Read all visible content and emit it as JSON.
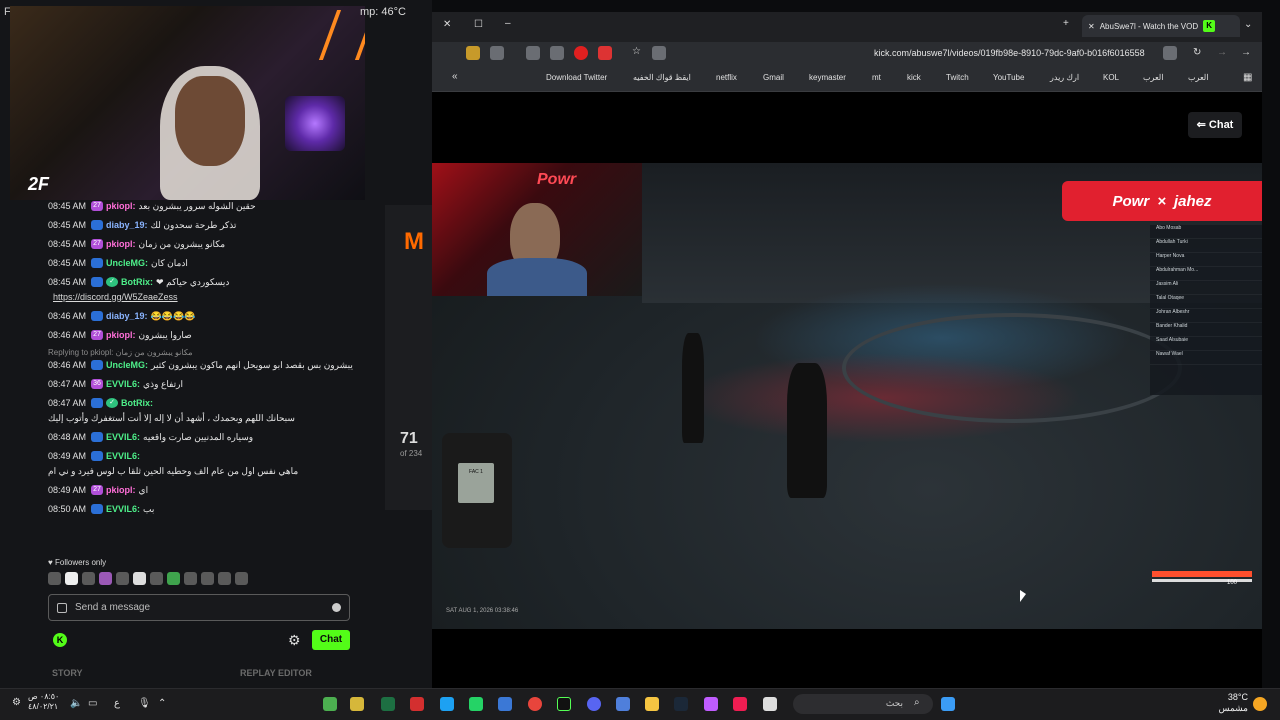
{
  "overlay": {
    "temp": "mp: 46°C",
    "corner_letter": "F"
  },
  "chat": {
    "messages": [
      {
        "time": "08:45 AM",
        "badge": "27",
        "badge_color": "#b14fd8",
        "user": "pkiopl:",
        "user_color": "#ff6fd8",
        "text": "حقين الشوله سرور يبشرون بعد"
      },
      {
        "time": "08:45 AM",
        "badge": "",
        "user": "diaby_19:",
        "user_color": "#8ab4ff",
        "text": "تذكر طرحة سحدون لك"
      },
      {
        "time": "08:45 AM",
        "badge": "27",
        "badge_color": "#b14fd8",
        "user": "pkiopl:",
        "user_color": "#ff6fd8",
        "text": "مكانو يبشرون من زمان"
      },
      {
        "time": "08:45 AM",
        "badge": "",
        "user": "UncleMG:",
        "user_color": "#4ef08a",
        "text": "ادمان كان"
      },
      {
        "time": "08:45 AM",
        "badge": "",
        "user": "BotRix:",
        "user_color": "#4ef08a",
        "text": "ديسكوردي حياكم ❤",
        "link": "https://discord.gg/W5ZeaeZess"
      },
      {
        "time": "08:46 AM",
        "badge": "",
        "user": "diaby_19:",
        "user_color": "#8ab4ff",
        "text": "😂😂😂😂"
      },
      {
        "time": "08:46 AM",
        "badge": "27",
        "badge_color": "#b14fd8",
        "user": "pkiopl:",
        "user_color": "#ff6fd8",
        "text": "صاروا يبشرون"
      },
      {
        "reply": "Replying to pkiopl: مكانو يبشرون من زمان",
        "time": "08:46 AM",
        "badge": "",
        "user": "UncleMG:",
        "user_color": "#4ef08a",
        "text": "يبشرون بس بقصد ابو سويحل انهم ماكون يبشرون كثير"
      },
      {
        "time": "08:47 AM",
        "badge": "36",
        "badge_color": "#b14fd8",
        "user": "EVVIL6:",
        "user_color": "#4ef08a",
        "text": "ارتفاع وذي"
      },
      {
        "time": "08:47 AM",
        "badge": "",
        "user": "BotRix:",
        "user_color": "#4ef08a",
        "text": "سبحانك اللهم وبحمدك ، أشهد أن لا إله إلا أنت أستغفرك وأتوب إليك"
      },
      {
        "time": "08:48 AM",
        "badge": "",
        "user": "EVVIL6:",
        "user_color": "#4ef08a",
        "text": "وسياره المدنيين صارت واقعيه"
      },
      {
        "time": "08:49 AM",
        "badge": "",
        "user": "EVVIL6:",
        "user_color": "#4ef08a",
        "text": "ماهي نفس اول من عام الف وحطيه الحين ثلقا ب لوس فيرد و ني ام"
      },
      {
        "time": "08:49 AM",
        "badge": "27",
        "badge_color": "#b14fd8",
        "user": "pkiopl:",
        "user_color": "#ff6fd8",
        "text": "اي"
      },
      {
        "time": "08:50 AM",
        "badge": "",
        "user": "EVVIL6:",
        "user_color": "#4ef08a",
        "text": "بب"
      }
    ],
    "followers_only": "Followers only",
    "input_placeholder": "Send a message",
    "send_label": "Chat",
    "story_label": "STORY",
    "replay_label": "REPLAY EDITOR"
  },
  "side_stats": {
    "number": "71",
    "of_total": "of 234"
  },
  "browser": {
    "tab_title": "AbuSwe7l - Watch the VOD",
    "url": "kick.com/abuswe7l/videos/019fb98e-8910-79dc-9af0-b016f6016558",
    "bookmarks": [
      "Download Twitter",
      "ايقظ قواك الخفيه",
      "netflix",
      "Gmail",
      "keymaster",
      "mt",
      "kick",
      "Twitch",
      "YouTube",
      "ارك ريدر",
      "KOL",
      "العرب",
      "العرب"
    ],
    "chat_toggle": "Chat"
  },
  "game": {
    "cam_brand": "Powr",
    "sponsor_left": "Powr",
    "sponsor_x": "×",
    "sponsor_right": "jahez",
    "scoreboard": [
      "Abo Mosab",
      "Abdullah Turki",
      "Harper Nova",
      "Abdulrahman Mo...",
      "Jassim Ali",
      "Talal Otaqee",
      "Johran Albeshr",
      "Bander Khalid",
      "Saad Alsubaie",
      "Nawaf Wael"
    ],
    "radio_label": "FAC 1",
    "hud_time": "SAT AUG 1, 2026 03:38:46",
    "hud_value": "100"
  },
  "taskbar": {
    "clock": "٠٨:٥٠ ص",
    "date": "٤٨/٠٢/٢١",
    "search_placeholder": "بحث",
    "weather_temp": "38°C",
    "weather_label": "مشمس"
  }
}
